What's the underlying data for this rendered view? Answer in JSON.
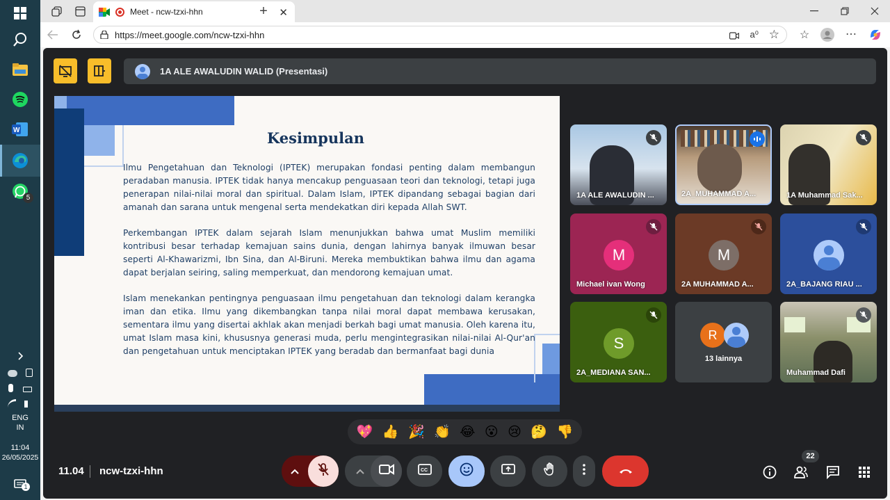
{
  "taskbar": {
    "whatsapp_badge": "5",
    "language_line1": "ENG",
    "language_line2": "IN",
    "time": "11:04",
    "date": "26/05/2025",
    "notifications_badge": "1"
  },
  "browser": {
    "tab_title": "Meet - ncw-tzxi-hhn",
    "url": "https://meet.google.com/ncw-tzxi-hhn"
  },
  "meet": {
    "presenter_label": "1A ALE AWALUDIN WALID (Presentasi)",
    "slide": {
      "title": "Kesimpulan",
      "paragraphs": [
        "Ilmu Pengetahuan dan Teknologi (IPTEK) merupakan fondasi penting dalam membangun peradaban manusia. IPTEK tidak hanya mencakup penguasaan teori dan teknologi, tetapi juga penerapan nilai-nilai moral dan spiritual. Dalam Islam, IPTEK dipandang sebagai bagian dari amanah dan sarana untuk mengenal serta mendekatkan diri kepada Allah SWT.",
        "Perkembangan IPTEK dalam sejarah Islam menunjukkan bahwa umat Muslim memiliki kontribusi besar terhadap kemajuan sains dunia, dengan lahirnya banyak ilmuwan besar seperti Al-Khawarizmi, Ibn Sina, dan Al-Biruni. Mereka membuktikan bahwa ilmu dan agama dapat berjalan seiring, saling memperkuat, dan mendorong kemajuan umat.",
        "Islam menekankan pentingnya penguasaan ilmu pengetahuan dan teknologi dalam kerangka iman dan etika. Ilmu yang dikembangkan tanpa nilai moral dapat membawa kerusakan, sementara ilmu yang disertai akhlak akan menjadi berkah bagi umat manusia. Oleh karena itu, umat Islam masa kini, khususnya generasi muda, perlu mengintegrasikan nilai-nilai Al-Qur'an dan pengetahuan untuk menciptakan IPTEK yang beradab dan bermanfaat bagi dunia"
      ]
    },
    "participants": [
      {
        "name": "1A ALE AWALUDIN ...",
        "type": "video"
      },
      {
        "name": "2A_MUHAMMAD A...",
        "type": "video"
      },
      {
        "name": "1A Muhammad Sak...",
        "type": "video"
      },
      {
        "name": "Michael ivan Wong",
        "initial": "M"
      },
      {
        "name": "2A MUHAMMAD A...",
        "initial": "M"
      },
      {
        "name": "2A_BAJANG RIAU ..."
      },
      {
        "name": "2A_MEDIANA SAN...",
        "initial": "S"
      },
      {
        "name": "13 lainnya",
        "initial": "R"
      },
      {
        "name": "Muhammad Dafi",
        "type": "video"
      }
    ],
    "reactions": [
      "💖",
      "👍",
      "🎉",
      "👏",
      "😂",
      "😮",
      "😢",
      "🤔",
      "👎"
    ],
    "time": "11.04",
    "meeting_code": "ncw-tzxi-hhn",
    "people_count": "22"
  }
}
